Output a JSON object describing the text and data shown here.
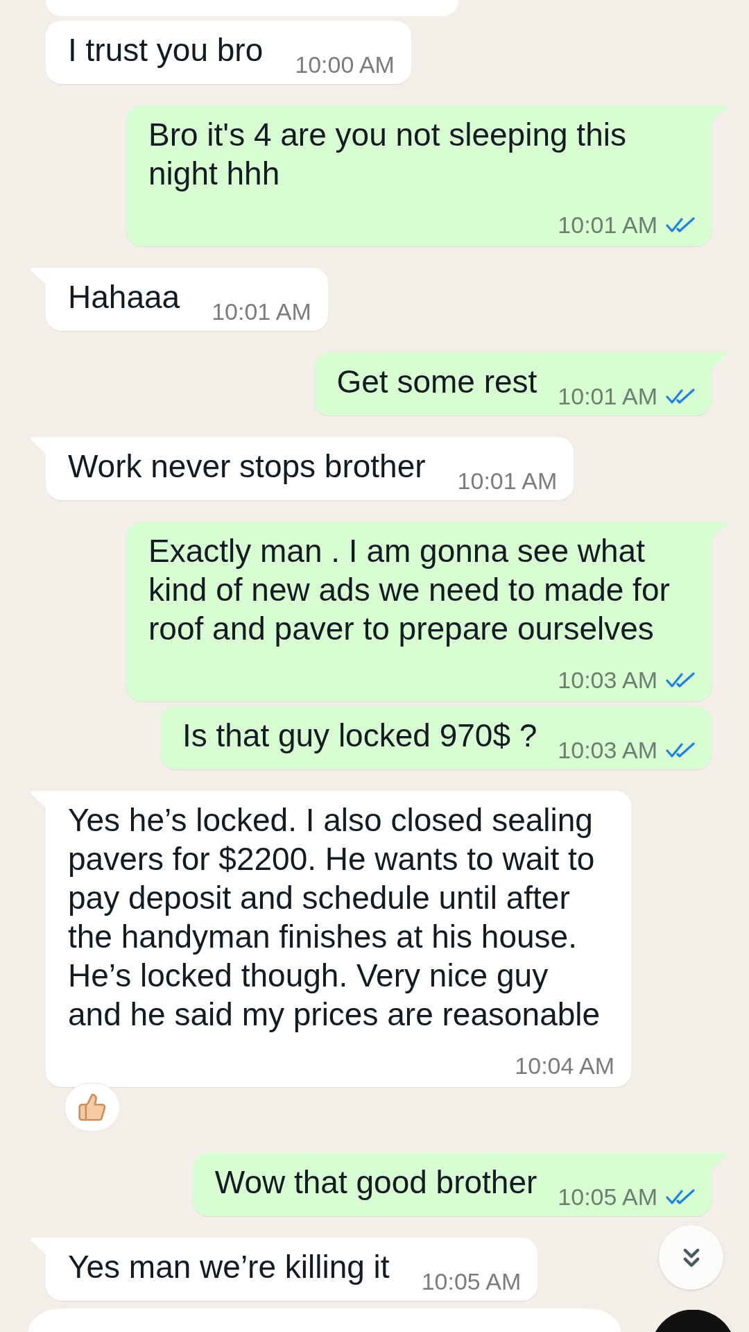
{
  "messages": [
    {
      "kind": "clipped",
      "outgoing": false
    },
    {
      "kind": "text",
      "outgoing": false,
      "tail": false,
      "text": "I trust you bro",
      "time": "10:00 AM",
      "reaction": false
    },
    {
      "kind": "text",
      "outgoing": true,
      "tail": true,
      "text": "Bro it's 4 are you not sleeping this\nnight hhh",
      "time": "10:01 AM",
      "read": true,
      "reaction": false
    },
    {
      "kind": "text",
      "outgoing": false,
      "tail": true,
      "text": "Hahaaa",
      "time": "10:01 AM",
      "reaction": false
    },
    {
      "kind": "text",
      "outgoing": true,
      "tail": true,
      "text": "Get some rest",
      "time": "10:01 AM",
      "read": true,
      "reaction": false
    },
    {
      "kind": "text",
      "outgoing": false,
      "tail": true,
      "text": "Work never stops brother",
      "time": "10:01 AM",
      "reaction": false
    },
    {
      "kind": "text",
      "outgoing": true,
      "tail": true,
      "text": "Exactly man . I am gonna see what\nkind of new ads we need to made for\nroof and paver to prepare ourselves",
      "time": "10:03 AM",
      "read": true,
      "reaction": false
    },
    {
      "kind": "text",
      "outgoing": true,
      "tail": false,
      "text": "Is that guy locked 970$ ?",
      "time": "10:03 AM",
      "read": true,
      "reaction": false
    },
    {
      "kind": "text",
      "outgoing": false,
      "tail": true,
      "text": "Yes he’s locked. I also closed sealing\npavers for $2200. He wants to wait to\npay deposit and schedule until after\nthe handyman finishes at his house.\nHe’s locked though. Very nice guy\nand he said my prices are reasonable",
      "time": "10:04 AM",
      "reaction": true
    },
    {
      "kind": "text",
      "outgoing": true,
      "tail": true,
      "text": "Wow that good brother",
      "time": "10:05 AM",
      "read": true,
      "reaction": false
    },
    {
      "kind": "text",
      "outgoing": false,
      "tail": true,
      "text": "Yes man we’re killing it",
      "time": "10:05 AM",
      "reaction": false
    }
  ]
}
